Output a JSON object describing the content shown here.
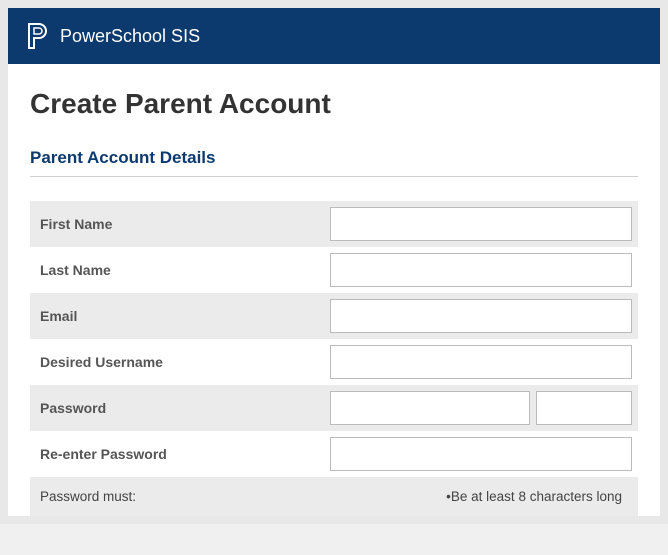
{
  "header": {
    "app_name": "PowerSchool SIS"
  },
  "page": {
    "title": "Create Parent Account",
    "section_title": "Parent Account Details"
  },
  "form": {
    "first_name_label": "First Name",
    "first_name_value": "",
    "last_name_label": "Last Name",
    "last_name_value": "",
    "email_label": "Email",
    "email_value": "",
    "username_label": "Desired Username",
    "username_value": "",
    "password_label": "Password",
    "password_value": "",
    "reenter_password_label": "Re-enter Password",
    "reenter_password_value": "",
    "password_rules_label": "Password must:",
    "password_rules_text": "•Be at least 8 characters long"
  }
}
